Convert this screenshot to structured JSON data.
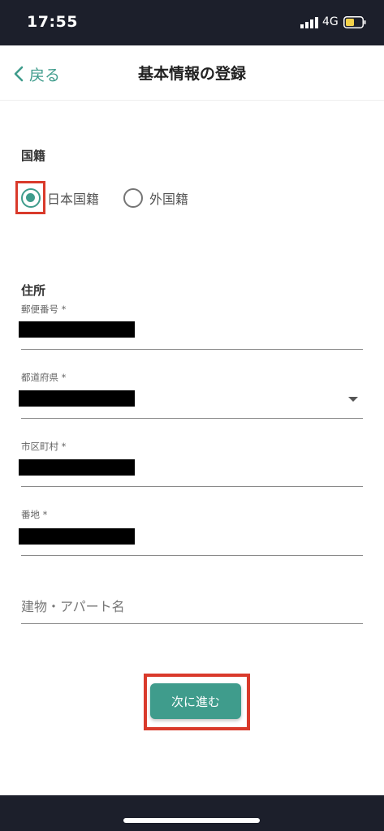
{
  "status_bar": {
    "time": "17:55",
    "network": "4G",
    "signal_icon": "signal-bars-icon",
    "battery_icon": "battery-low-icon",
    "battery_color": "#f3d24a"
  },
  "nav": {
    "back_label": "戻る",
    "back_icon": "chevron-left-icon",
    "title": "基本情報の登録"
  },
  "nationality": {
    "title": "国籍",
    "options": [
      {
        "label": "日本国籍",
        "selected": true
      },
      {
        "label": "外国籍",
        "selected": false
      }
    ]
  },
  "address": {
    "title": "住所",
    "fields": [
      {
        "label": "郵便番号 *",
        "value_redacted": true
      },
      {
        "label": "都道府県 *",
        "value_redacted": true,
        "dropdown": true
      },
      {
        "label": "市区町村 *",
        "value_redacted": true
      },
      {
        "label": "番地 *",
        "value_redacted": true
      }
    ],
    "building_placeholder": "建物・アパート名"
  },
  "next_button": {
    "label": "次に進む"
  },
  "colors": {
    "accent": "#3f9c8c",
    "highlight": "#d93a2b",
    "status_bar_bg": "#1c1f2b"
  }
}
